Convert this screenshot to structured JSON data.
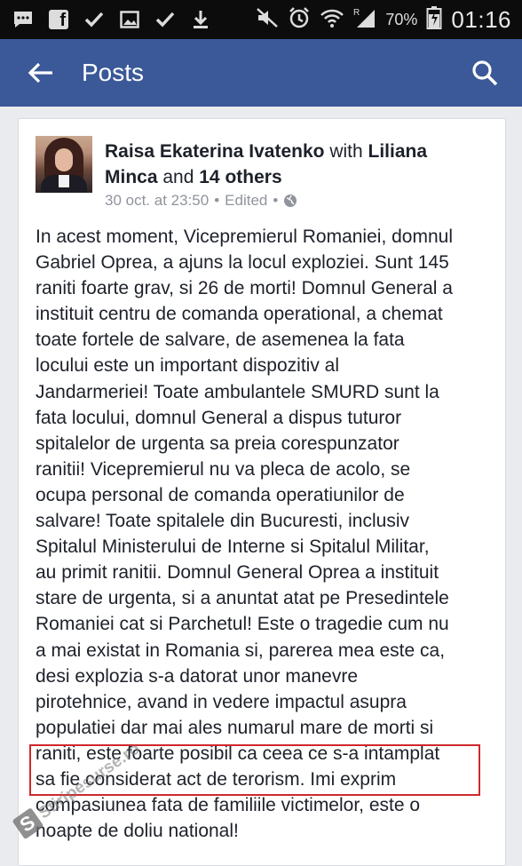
{
  "status_bar": {
    "battery_percent": "70%",
    "clock": "01:16",
    "left_icons": [
      "chat-icon",
      "facebook-icon",
      "check-icon",
      "image-icon",
      "check-icon",
      "download-icon"
    ],
    "right_icons": [
      "mute-icon",
      "alarm-icon",
      "wifi-icon",
      "signal-icon",
      "battery-charging-icon"
    ]
  },
  "app_bar": {
    "title": "Posts",
    "background": "#3b5998"
  },
  "post": {
    "author": "Raisa Ekaterina Ivatenko",
    "with_word": "with",
    "tagged_name_line1": "Liliana",
    "tagged_name_line2": "Minca",
    "and_word": "and",
    "others_label": "14 others",
    "timestamp": "30 oct. at 23:50",
    "edited_label": "Edited",
    "separator": "•",
    "lines": [
      "In acest moment, Vicepremierul Romaniei, domnul",
      "Gabriel Oprea, a ajuns la locul exploziei. Sunt 145",
      "raniti foarte grav, si 26 de morti! Domnul General a",
      "instituit centru de comanda operational, a chemat",
      "toate fortele de salvare, de asemenea la fata",
      "locului este un important dispozitiv al",
      "Jandarmeriei! Toate ambulantele SMURD sunt la",
      "fata locului, domnul General a dispus tuturor",
      "spitalelor de urgenta sa preia corespunzator",
      "ranitii! Vicepremierul nu va pleca de acolo, se",
      "ocupa personal de comanda operatiunilor de",
      "salvare! Toate spitalele din Bucuresti, inclusiv",
      "Spitalul Ministerului de Interne si Spitalul Militar,",
      "au primit ranitii. Domnul General Oprea a instituit",
      "stare de urgenta, si a anuntat atat pe Presedintele",
      "Romaniei cat si Parchetul! Este o tragedie cum nu",
      "a mai existat in Romania si, parerea mea este ca,",
      "desi explozia s-a datorat unor manevre",
      "pirotehnice, avand in vedere impactul asupra",
      "populatiei dar mai ales numarul mare de morti si",
      "raniti, este foarte posibil ca ceea ce s-a intamplat",
      "sa fie considerat act de terorism. Imi exprim",
      "compasiunea fata de familiile victimelor, este o",
      "noapte de  doliu national!"
    ]
  },
  "highlight_color": "#d0282c",
  "watermark_text": "Stiripesurse.ro"
}
